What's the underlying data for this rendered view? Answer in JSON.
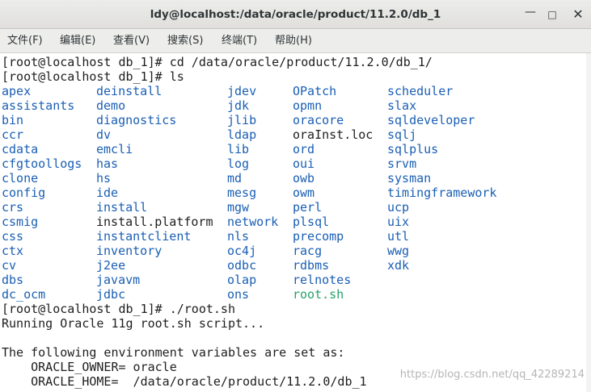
{
  "window": {
    "title": "ldy@localhost:/data/oracle/product/11.2.0/db_1",
    "minimize_icon": "minimize-icon",
    "maximize_icon": "maximize-icon",
    "close_icon": "close-icon"
  },
  "menubar": {
    "items": [
      {
        "label": "文件(F)"
      },
      {
        "label": "编辑(E)"
      },
      {
        "label": "查看(V)"
      },
      {
        "label": "搜索(S)"
      },
      {
        "label": "终端(T)"
      },
      {
        "label": "帮助(H)"
      }
    ]
  },
  "terminal": {
    "cmd1": "[root@localhost db_1]# cd /data/oracle/product/11.2.0/db_1/",
    "cmd2": "[root@localhost db_1]# ls",
    "listing": [
      [
        {
          "name": "apex",
          "kind": "dir"
        },
        {
          "name": "deinstall",
          "kind": "dir"
        },
        {
          "name": "jdev",
          "kind": "dir"
        },
        {
          "name": "OPatch",
          "kind": "dir"
        },
        {
          "name": "scheduler",
          "kind": "dir"
        }
      ],
      [
        {
          "name": "assistants",
          "kind": "dir"
        },
        {
          "name": "demo",
          "kind": "dir"
        },
        {
          "name": "jdk",
          "kind": "dir"
        },
        {
          "name": "opmn",
          "kind": "dir"
        },
        {
          "name": "slax",
          "kind": "dir"
        }
      ],
      [
        {
          "name": "bin",
          "kind": "dir"
        },
        {
          "name": "diagnostics",
          "kind": "dir"
        },
        {
          "name": "jlib",
          "kind": "dir"
        },
        {
          "name": "oracore",
          "kind": "dir"
        },
        {
          "name": "sqldeveloper",
          "kind": "dir"
        }
      ],
      [
        {
          "name": "ccr",
          "kind": "dir"
        },
        {
          "name": "dv",
          "kind": "dir"
        },
        {
          "name": "ldap",
          "kind": "dir"
        },
        {
          "name": "oraInst.loc",
          "kind": "file"
        },
        {
          "name": "sqlj",
          "kind": "dir"
        }
      ],
      [
        {
          "name": "cdata",
          "kind": "dir"
        },
        {
          "name": "emcli",
          "kind": "dir"
        },
        {
          "name": "lib",
          "kind": "dir"
        },
        {
          "name": "ord",
          "kind": "dir"
        },
        {
          "name": "sqlplus",
          "kind": "dir"
        }
      ],
      [
        {
          "name": "cfgtoollogs",
          "kind": "dir"
        },
        {
          "name": "has",
          "kind": "dir"
        },
        {
          "name": "log",
          "kind": "dir"
        },
        {
          "name": "oui",
          "kind": "dir"
        },
        {
          "name": "srvm",
          "kind": "dir"
        }
      ],
      [
        {
          "name": "clone",
          "kind": "dir"
        },
        {
          "name": "hs",
          "kind": "dir"
        },
        {
          "name": "md",
          "kind": "dir"
        },
        {
          "name": "owb",
          "kind": "dir"
        },
        {
          "name": "sysman",
          "kind": "dir"
        }
      ],
      [
        {
          "name": "config",
          "kind": "dir"
        },
        {
          "name": "ide",
          "kind": "dir"
        },
        {
          "name": "mesg",
          "kind": "dir"
        },
        {
          "name": "owm",
          "kind": "dir"
        },
        {
          "name": "timingframework",
          "kind": "dir"
        }
      ],
      [
        {
          "name": "crs",
          "kind": "dir"
        },
        {
          "name": "install",
          "kind": "dir"
        },
        {
          "name": "mgw",
          "kind": "dir"
        },
        {
          "name": "perl",
          "kind": "dir"
        },
        {
          "name": "ucp",
          "kind": "dir"
        }
      ],
      [
        {
          "name": "csmig",
          "kind": "dir"
        },
        {
          "name": "install.platform",
          "kind": "file"
        },
        {
          "name": "network",
          "kind": "dir"
        },
        {
          "name": "plsql",
          "kind": "dir"
        },
        {
          "name": "uix",
          "kind": "dir"
        }
      ],
      [
        {
          "name": "css",
          "kind": "dir"
        },
        {
          "name": "instantclient",
          "kind": "dir"
        },
        {
          "name": "nls",
          "kind": "dir"
        },
        {
          "name": "precomp",
          "kind": "dir"
        },
        {
          "name": "utl",
          "kind": "dir"
        }
      ],
      [
        {
          "name": "ctx",
          "kind": "dir"
        },
        {
          "name": "inventory",
          "kind": "dir"
        },
        {
          "name": "oc4j",
          "kind": "dir"
        },
        {
          "name": "racg",
          "kind": "dir"
        },
        {
          "name": "wwg",
          "kind": "dir"
        }
      ],
      [
        {
          "name": "cv",
          "kind": "dir"
        },
        {
          "name": "j2ee",
          "kind": "dir"
        },
        {
          "name": "odbc",
          "kind": "dir"
        },
        {
          "name": "rdbms",
          "kind": "dir"
        },
        {
          "name": "xdk",
          "kind": "dir"
        }
      ],
      [
        {
          "name": "dbs",
          "kind": "dir"
        },
        {
          "name": "javavm",
          "kind": "dir"
        },
        {
          "name": "olap",
          "kind": "dir"
        },
        {
          "name": "relnotes",
          "kind": "dir"
        }
      ],
      [
        {
          "name": "dc_ocm",
          "kind": "dir"
        },
        {
          "name": "jdbc",
          "kind": "dir"
        },
        {
          "name": "ons",
          "kind": "dir"
        },
        {
          "name": "root.sh",
          "kind": "exec"
        }
      ]
    ],
    "cmd3": "[root@localhost db_1]# ./root.sh",
    "out1": "Running Oracle 11g root.sh script...",
    "out2": "",
    "out3": "The following environment variables are set as:",
    "out4": "    ORACLE_OWNER= oracle",
    "out5": "    ORACLE_HOME=  /data/oracle/product/11.2.0/db_1"
  },
  "colors": {
    "directory": "#1a5fb4",
    "executable": "#26a269",
    "regular_file": "#1e1e1e"
  },
  "watermark": "https://blog.csdn.net/qq_42289214"
}
